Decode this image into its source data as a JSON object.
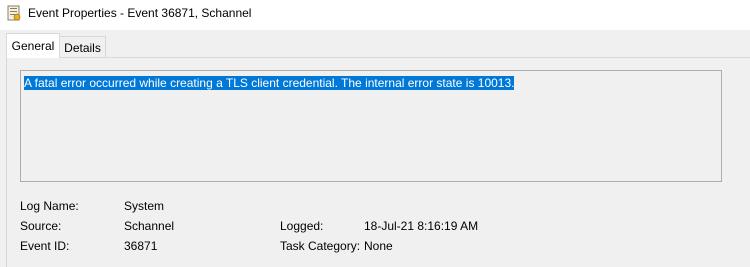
{
  "window": {
    "title": "Event Properties - Event 36871, Schannel"
  },
  "tabs": [
    {
      "label": "General",
      "selected": true
    },
    {
      "label": "Details",
      "selected": false
    }
  ],
  "description": {
    "text": "A fatal error occurred while creating a TLS client credential. The internal error state is 10013.",
    "selection_color": "#0078d7"
  },
  "fields": {
    "log_name": {
      "label": "Log Name:",
      "value": "System"
    },
    "source": {
      "label": "Source:",
      "value": "Schannel"
    },
    "logged": {
      "label": "Logged:",
      "value": "18-Jul-21 8:16:19 AM"
    },
    "event_id": {
      "label": "Event ID:",
      "value": "36871"
    },
    "task_category": {
      "label": "Task Category:",
      "value": "None"
    }
  },
  "icons": {
    "app": "event-viewer-icon"
  }
}
